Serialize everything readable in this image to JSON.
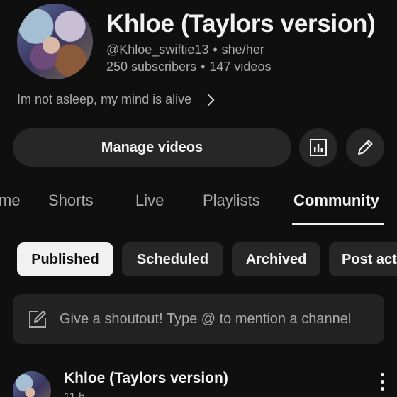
{
  "channel": {
    "name": "Khloe (Taylors version)",
    "handle": "@Khloe_swiftie13",
    "pronouns": "she/her",
    "subscribers": "250 subscribers",
    "videos": "147 videos",
    "separator": "•",
    "tagline": "Im not asleep, my mind is alive"
  },
  "actions": {
    "manage_label": "Manage videos",
    "stats_icon": "analytics-icon",
    "edit_icon": "pencil-icon"
  },
  "tabs": [
    {
      "label": "me",
      "active": false
    },
    {
      "label": "Shorts",
      "active": false
    },
    {
      "label": "Live",
      "active": false
    },
    {
      "label": "Playlists",
      "active": false
    },
    {
      "label": "Community",
      "active": true
    }
  ],
  "filters": [
    {
      "label": "Published",
      "active": true
    },
    {
      "label": "Scheduled",
      "active": false
    },
    {
      "label": "Archived",
      "active": false
    },
    {
      "label": "Post act",
      "active": false
    }
  ],
  "composer": {
    "placeholder": "Give a shoutout! Type @ to mention a channel",
    "icon": "compose-icon"
  },
  "post": {
    "author": "Khloe (Taylors version)",
    "time": "11 h"
  },
  "colors": {
    "background": "#0f0f0f",
    "surface": "#272727",
    "text": "#f1f1f1",
    "muted": "#aaaaaa"
  }
}
